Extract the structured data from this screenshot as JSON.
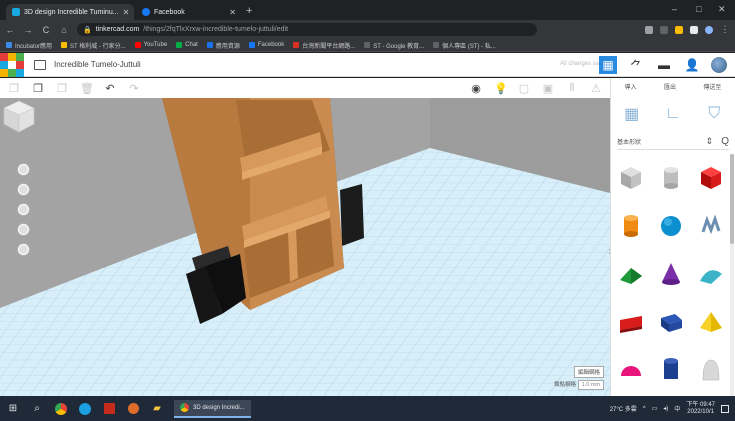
{
  "browser": {
    "tabs": [
      {
        "title": "3D design Incredible Tuminu...",
        "favicon_color": "#1aa8e0",
        "active": true
      },
      {
        "title": "Facebook",
        "favicon_color": "#1877f2",
        "active": false
      }
    ],
    "new_tab_glyph": "+",
    "window_controls": [
      "–",
      "□",
      "✕"
    ],
    "nav": {
      "back": "←",
      "forward": "→",
      "reload": "C",
      "home": "⌂"
    },
    "url_host": "tinkercad.com",
    "url_path": "/things/2fqTlxXrxw-incredible-tumelo-juttuli/edit",
    "bookmarks": [
      {
        "label": "Incubator應用",
        "color": "#3c8ce7"
      },
      {
        "label": "ST 格利威 - 行家分...",
        "color": "#fbbc04"
      },
      {
        "label": "YouTube",
        "color": "#ff0000"
      },
      {
        "label": "Chat",
        "color": "#00ac47"
      },
      {
        "label": "應用資源",
        "color": "#1a73e8"
      },
      {
        "label": "Facebook",
        "color": "#1877f2"
      },
      {
        "label": "台灣新聞平台網路...",
        "color": "#d93025"
      },
      {
        "label": "ST - Google 教育...",
        "color": "#5f6368"
      },
      {
        "label": "個人專區 (ST) - 私...",
        "color": "#5f6368"
      }
    ]
  },
  "app": {
    "design_name": "Incredible Tumelo-Juttuli",
    "autosave": "All changes saved",
    "logo_colors": [
      "#e43b3b",
      "#f4b400",
      "#4caf50",
      "#1aa8e0",
      "#ffffff",
      "#e43b3b",
      "#f4b400",
      "#4caf50",
      "#1aa8e0"
    ],
    "toolbar": {
      "copy": "❐",
      "paste": "❐",
      "duplicate": "❐",
      "delete": "🗑",
      "undo": "↶",
      "redo": "↷",
      "notes": "◉",
      "show_all": "💡",
      "group": "▢",
      "ungroup": "▣",
      "align": "⫴",
      "mirror": "⚠"
    },
    "panel": {
      "tabs": [
        "導入",
        "匯出",
        "傳送至"
      ],
      "category": "基本形狀",
      "chevron": "⌃⌄",
      "search_glyph": "Q",
      "shapes": [
        "Box",
        "Cylinder",
        "Box (red)",
        "Cylinder (orange)",
        "Sphere",
        "Scribble",
        "Roof",
        "Cone",
        "Round Roof",
        "Text",
        "Polygon",
        "Pyramid",
        "Half Sphere",
        "Tube",
        "Paraboloid"
      ]
    },
    "grid": {
      "edit_label": "編輯網格",
      "snap_label": "鎖點網格",
      "snap_value": "1.0 mm"
    }
  },
  "taskbar": {
    "search_glyph": "⌕",
    "app_label": "3D design Incredi...",
    "weather": "27°C 多雲",
    "lang": "中",
    "time": "下午 09:47",
    "date": "2022/10/1"
  },
  "colors": {
    "accent": "#2a8ae0",
    "shelf_wood": "#c98b4f",
    "shelf_dark": "#9a6330",
    "grid": "#c5e4f5"
  }
}
